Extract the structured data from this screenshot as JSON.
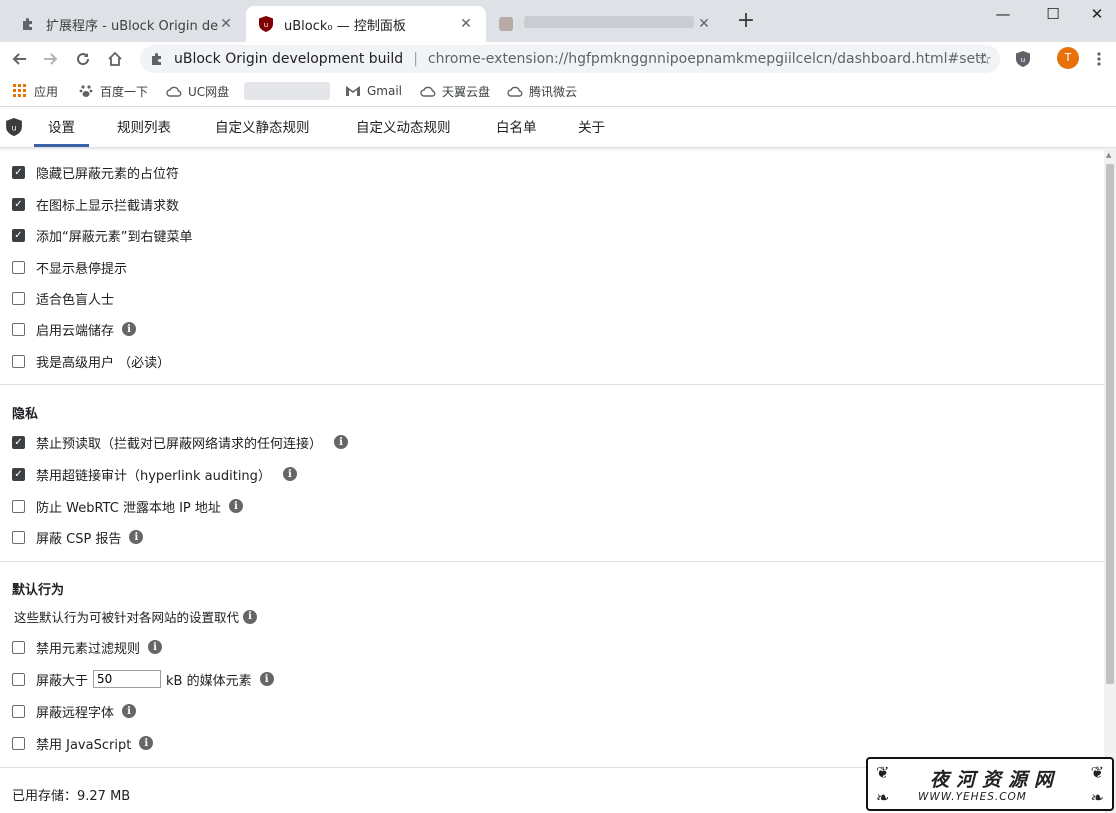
{
  "browser": {
    "tabs": [
      {
        "title": "扩展程序 - uBlock Origin devel",
        "close": "✕"
      },
      {
        "title": "uBlock₀ — 控制面板",
        "close": "✕"
      },
      {
        "title": "",
        "close": "✕"
      }
    ],
    "new_tab": "+",
    "window": {
      "minimize": "—",
      "maximize": "☐",
      "close": "✕"
    },
    "omnibox": {
      "site": "uBlock Origin development build",
      "separator": "|",
      "url": "chrome-extension://hgfpmknggnnipoepnamkmepgiilcelcn/dashboard.html#sett..."
    },
    "avatar_letter": "T",
    "bookmarks": [
      {
        "label": "应用",
        "icon": "apps-grid-icon"
      },
      {
        "label": "百度一下",
        "icon": "baidu-paw-icon"
      },
      {
        "label": "UC网盘",
        "icon": "cloud-icon"
      },
      {
        "label": "Gmail",
        "icon": "gmail-icon"
      },
      {
        "label": "天翼云盘",
        "icon": "cloud-icon"
      },
      {
        "label": "腾讯微云",
        "icon": "cloud-icon"
      }
    ]
  },
  "dashboard": {
    "tabs": [
      "设置",
      "规则列表",
      "自定义静态规则",
      "自定义动态规则",
      "白名单",
      "关于"
    ],
    "active_tab": "设置",
    "appearance": [
      {
        "label": "隐藏已屏蔽元素的占位符",
        "checked": true,
        "info": false
      },
      {
        "label": "在图标上显示拦截请求数",
        "checked": true,
        "info": false
      },
      {
        "label": "添加“屏蔽元素”到右键菜单",
        "checked": true,
        "info": false
      },
      {
        "label": "不显示悬停提示",
        "checked": false,
        "info": false
      },
      {
        "label": "适合色盲人士",
        "checked": false,
        "info": false
      },
      {
        "label": "启用云端储存",
        "checked": false,
        "info": true
      },
      {
        "label": "我是高级用户 （必读）",
        "checked": false,
        "info": false
      }
    ],
    "privacy": {
      "heading": "隐私",
      "items": [
        {
          "label": "禁止预读取（拦截对已屏蔽网络请求的任何连接）",
          "checked": true,
          "info": true
        },
        {
          "label": "禁用超链接审计（hyperlink auditing）",
          "checked": true,
          "info": true
        },
        {
          "label": "防止 WebRTC 泄露本地 IP 地址",
          "checked": false,
          "info": true
        },
        {
          "label": "屏蔽 CSP 报告",
          "checked": false,
          "info": true
        }
      ]
    },
    "defaults": {
      "heading": "默认行为",
      "note": "这些默认行为可被针对各网站的设置取代",
      "items": [
        {
          "label": "禁用元素过滤规则",
          "checked": false,
          "info": true
        },
        {
          "label_before": "屏蔽大于",
          "value": "50",
          "label_after": "kB 的媒体元素",
          "checked": false,
          "info": true
        },
        {
          "label": "屏蔽远程字体",
          "checked": false,
          "info": true
        },
        {
          "label": "禁用 JavaScript",
          "checked": false,
          "info": true
        }
      ]
    },
    "storage_used": "已用存储：9.27 MB",
    "info_glyph": "i",
    "check_glyph": "✓"
  },
  "watermark": {
    "title": "夜河资源网",
    "url": "WWW.YEHES.COM"
  }
}
